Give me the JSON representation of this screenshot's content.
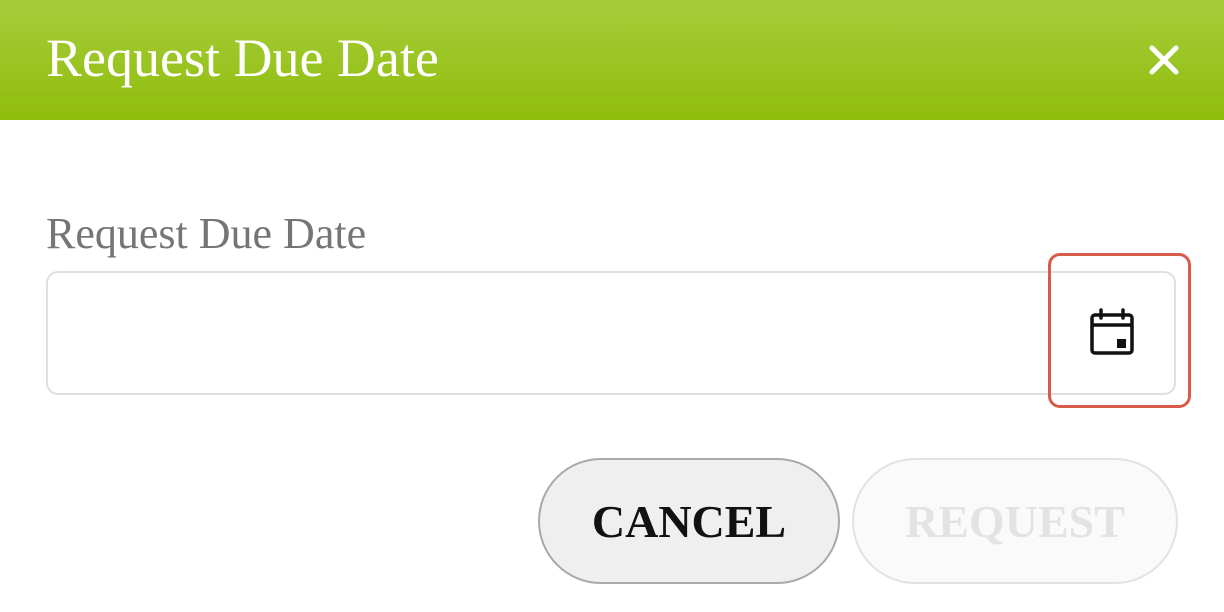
{
  "dialog": {
    "title": "Request Due Date",
    "close_icon": "close-icon",
    "header_color": "#96c11f"
  },
  "form": {
    "due_date_label": "Request Due Date",
    "due_date_value": "",
    "due_date_placeholder": "",
    "calendar_icon": "calendar-icon",
    "highlight_color": "#d75c4a"
  },
  "actions": {
    "cancel_label": "CANCEL",
    "request_label": "REQUEST",
    "request_disabled": true
  }
}
